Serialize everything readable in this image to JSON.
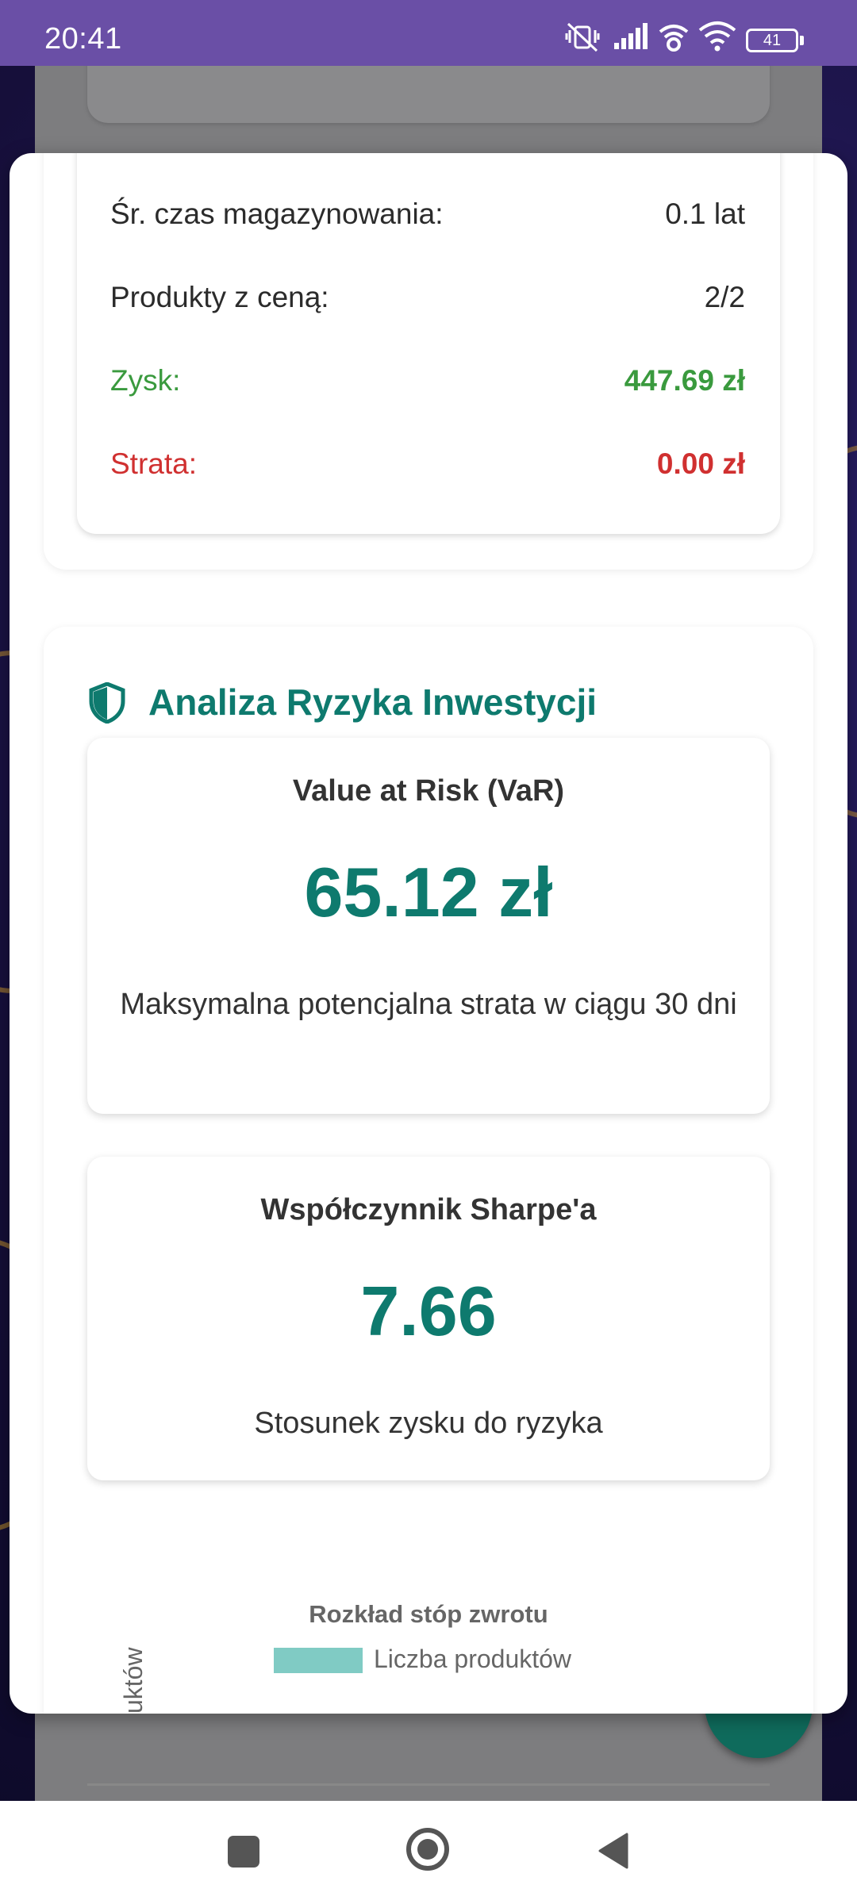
{
  "status_bar": {
    "time": "20:41",
    "battery": "41",
    "icons": [
      "vibrate-off-icon",
      "signal-icon",
      "wifi-calling-icon",
      "wifi-icon",
      "battery-icon"
    ]
  },
  "stats": {
    "rows": [
      {
        "label": "Śr. czas magazynowania:",
        "value": "0.1 lat"
      },
      {
        "label": "Produkty z ceną:",
        "value": "2/2"
      },
      {
        "label": "Zysk:",
        "value": "447.69 zł"
      },
      {
        "label": "Strata:",
        "value": "0.00 zł"
      }
    ]
  },
  "risk": {
    "title": "Analiza Ryzyka Inwestycji",
    "var": {
      "title": "Value at Risk (VaR)",
      "value": "65.12 zł",
      "description": "Maksymalna potencjalna strata w ciągu 30 dni"
    },
    "sharpe": {
      "title": "Współczynnik Sharpe'a",
      "value": "7.66",
      "description": "Stosunek zysku do ryzyka"
    },
    "chart": {
      "title": "Rozkład stóp zwrotu",
      "legend": "Liczba produktów",
      "y_label_visible": "uktów"
    }
  },
  "colors": {
    "accent": "#0e7a6e",
    "profit": "#3a9a3e",
    "loss": "#d03030",
    "status_bar": "#6a4fa6",
    "legend_swatch": "#80cbc4"
  },
  "nav": [
    "recents-button",
    "home-button",
    "back-button"
  ]
}
